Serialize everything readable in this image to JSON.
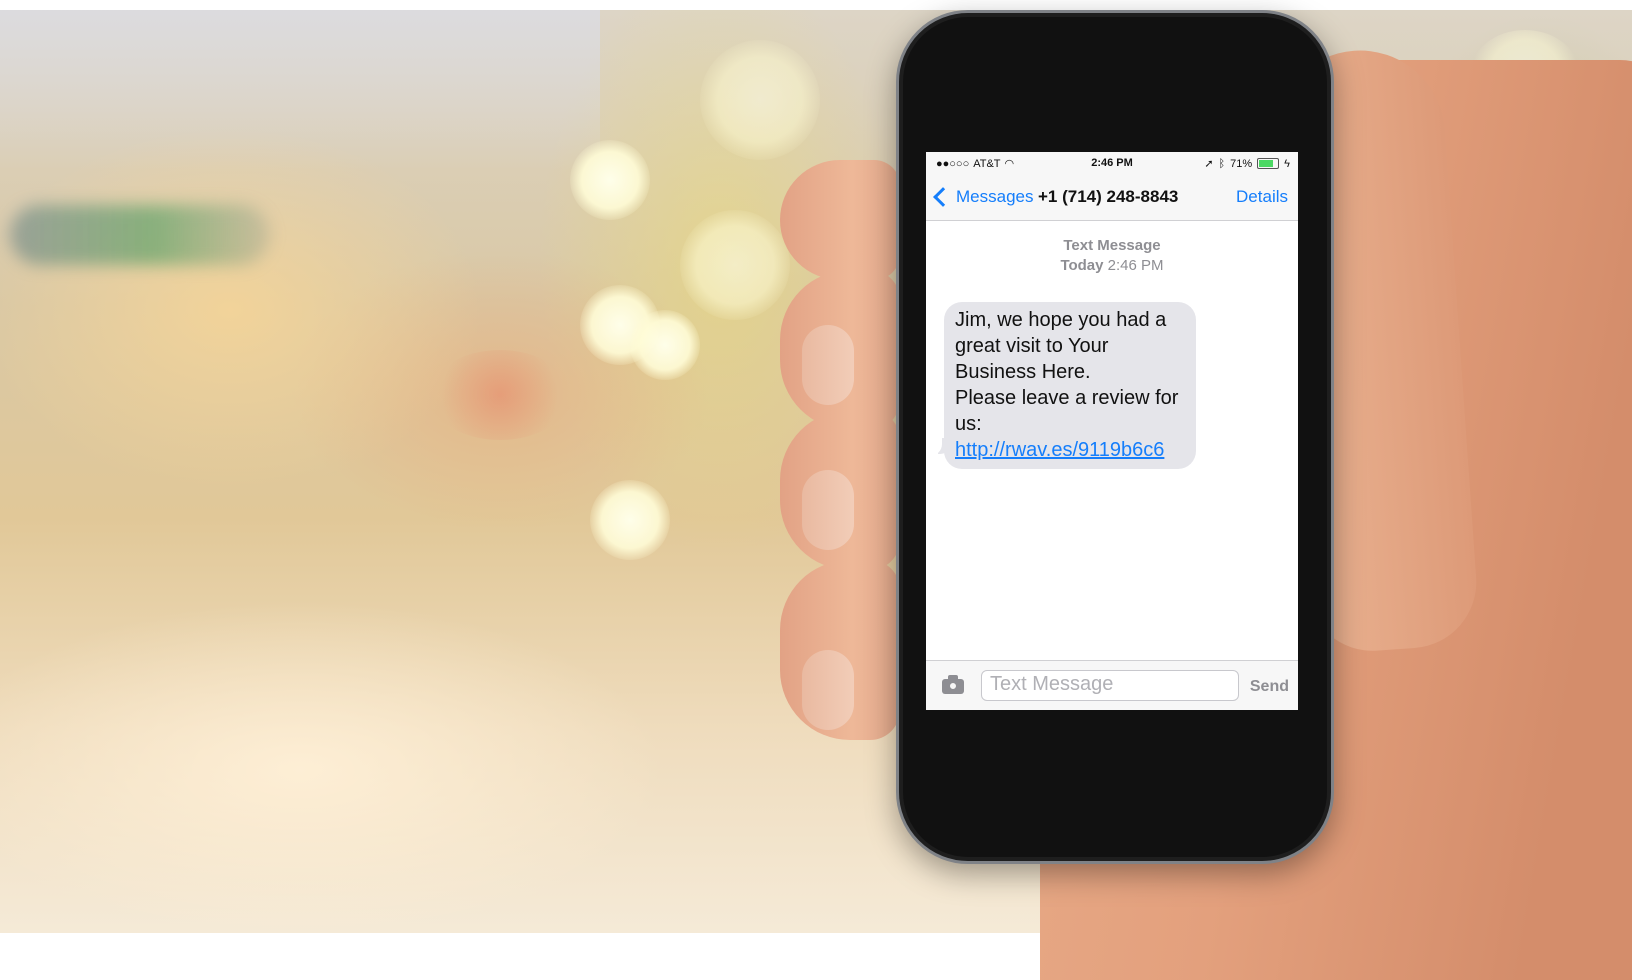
{
  "status_bar": {
    "signal_dots": "●●○○○",
    "carrier": "AT&T",
    "wifi_icon": "wifi-icon",
    "time": "2:46 PM",
    "location_icon": "➚",
    "bluetooth_icon": "ᛒ",
    "battery_percent": "71%",
    "charging_icon": "ϟ"
  },
  "nav": {
    "back_label": "Messages",
    "contact": "+1 (714) 248-8843",
    "details_label": "Details"
  },
  "thread": {
    "type_label": "Text Message",
    "day": "Today",
    "time": "2:46 PM"
  },
  "message": {
    "line1": "Jim, we hope you had a great visit to Your Business Here.",
    "line2_prefix": "Please leave a review for us: ",
    "link": "http://rwav.es/9119b6c6"
  },
  "compose": {
    "placeholder": "Text Message",
    "send_label": "Send",
    "camera_icon": "camera-icon"
  },
  "colors": {
    "ios_blue": "#157efb",
    "bubble_gray": "#e5e5ea",
    "label_gray": "#8e8e93",
    "battery_green": "#4cd964"
  }
}
